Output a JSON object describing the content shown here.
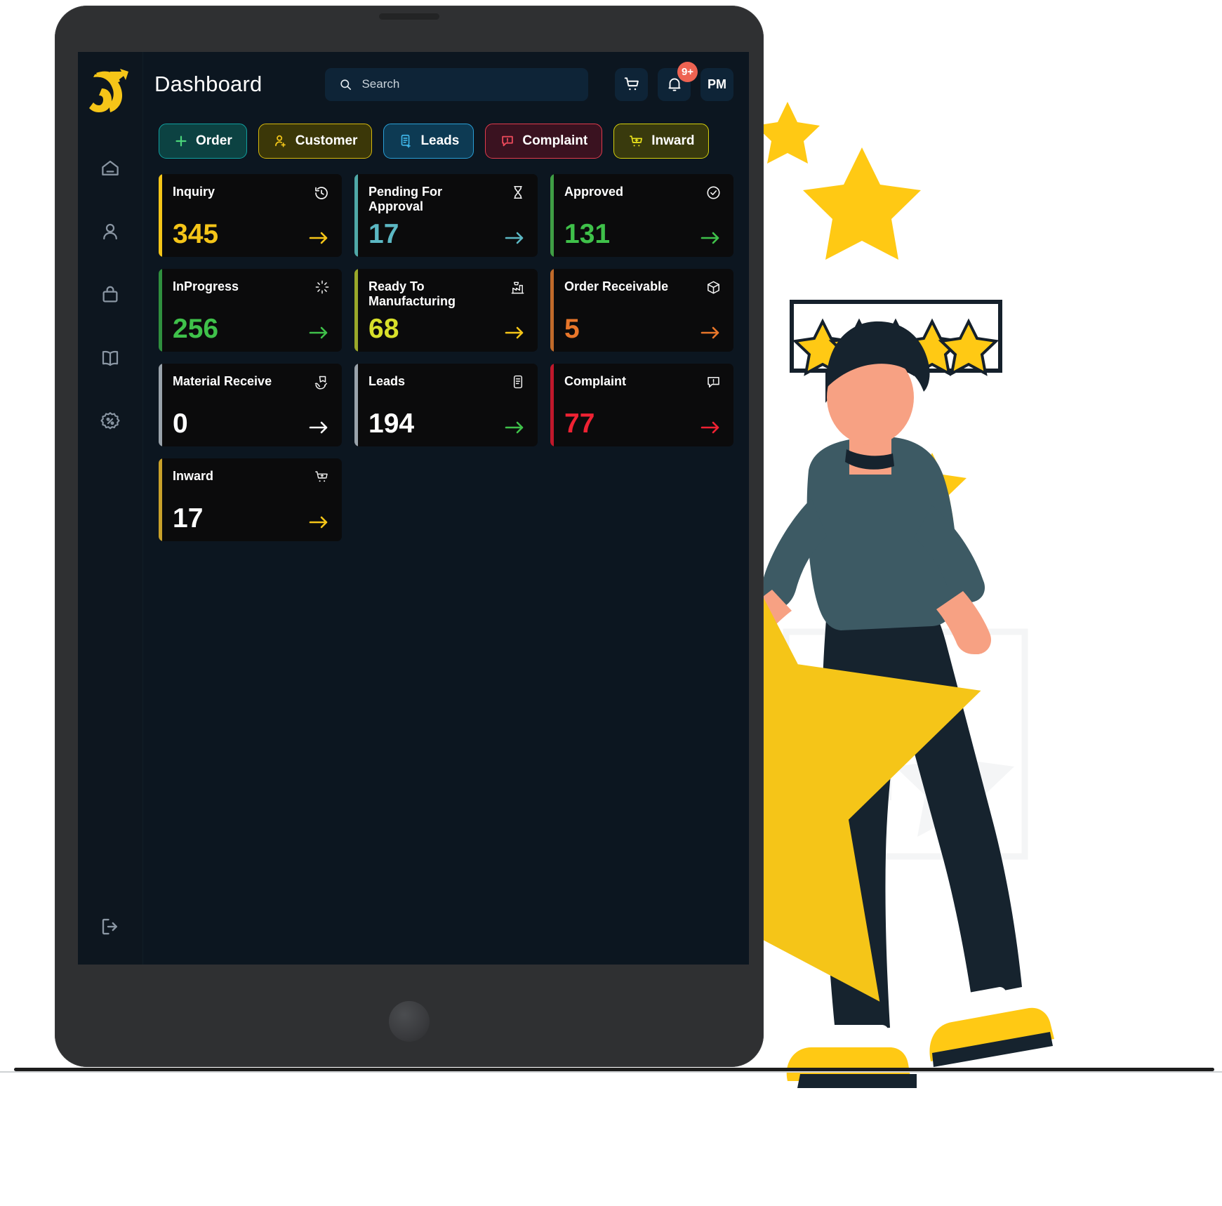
{
  "app": {
    "page_title": "Dashboard",
    "logo_name": "brand-logo"
  },
  "search": {
    "placeholder": "Search",
    "value": ""
  },
  "topbar": {
    "cart_icon": "cart-icon",
    "bell_icon": "bell-icon",
    "notification_count": "9+",
    "avatar_initials": "PM"
  },
  "sidebar": {
    "items": [
      {
        "icon": "home-icon",
        "name": "sidebar-item-home"
      },
      {
        "icon": "user-icon",
        "name": "sidebar-item-users"
      },
      {
        "icon": "bag-icon",
        "name": "sidebar-item-orders"
      },
      {
        "icon": "book-icon",
        "name": "sidebar-item-catalog"
      },
      {
        "icon": "percent-badge-icon",
        "name": "sidebar-item-offers"
      }
    ],
    "logout_icon": "logout-icon"
  },
  "quick_actions": [
    {
      "label": "Order",
      "icon": "plus-icon",
      "border": "#11a0a0",
      "bg": "#0c4242",
      "icon_color": "#4bd47a"
    },
    {
      "label": "Customer",
      "icon": "user-plus-icon",
      "border": "#d6b80d",
      "bg": "#3b3708",
      "icon_color": "#f0c419"
    },
    {
      "label": "Leads",
      "icon": "leads-doc-icon",
      "border": "#2a9fd6",
      "bg": "#0d3a53",
      "icon_color": "#3fb5e8"
    },
    {
      "label": "Complaint",
      "icon": "complaint-icon",
      "border": "#e03b4d",
      "bg": "#3a1220",
      "icon_color": "#ef4b5c"
    },
    {
      "label": "Inward",
      "icon": "inward-cart-icon",
      "border": "#d6d10d",
      "bg": "#393a0d",
      "icon_color": "#ece41c"
    }
  ],
  "stat_cards": [
    {
      "title": "Inquiry",
      "value": "345",
      "icon": "history-icon",
      "accent": "#f5c518",
      "value_color": "#f5c518",
      "arrow_color": "#f5c518"
    },
    {
      "title": "Pending For Approval",
      "value": "17",
      "icon": "hourglass-icon",
      "accent": "#4fa8a8",
      "value_color": "#5cb8c4",
      "arrow_color": "#5cb8c4"
    },
    {
      "title": "Approved",
      "value": "131",
      "icon": "check-circle-icon",
      "accent": "#3f9e44",
      "value_color": "#3fc14a",
      "arrow_color": "#3fc14a"
    },
    {
      "title": "InProgress",
      "value": "256",
      "icon": "spinner-icon",
      "accent": "#2f8f3e",
      "value_color": "#3fc14a",
      "arrow_color": "#3fc14a"
    },
    {
      "title": "Ready To Manufacturing",
      "value": "68",
      "icon": "factory-icon",
      "accent": "#9aa82a",
      "value_color": "#d8e02a",
      "arrow_color": "#f5c518"
    },
    {
      "title": "Order Receivable",
      "value": "5",
      "icon": "box-icon",
      "accent": "#c06a2a",
      "value_color": "#e8762a",
      "arrow_color": "#e8762a"
    },
    {
      "title": "Material Receive",
      "value": "0",
      "icon": "package-hand-icon",
      "accent": "#9aa3ab",
      "value_color": "#ffffff",
      "arrow_color": "#ffffff"
    },
    {
      "title": "Leads",
      "value": "194",
      "icon": "list-doc-icon",
      "accent": "#9aa3ab",
      "value_color": "#ffffff",
      "arrow_color": "#3fc14a"
    },
    {
      "title": "Complaint",
      "value": "77",
      "icon": "chat-alert-icon",
      "accent": "#c0182b",
      "value_color": "#ef2233",
      "arrow_color": "#ef2233"
    },
    {
      "title": "Inward",
      "value": "17",
      "icon": "cart-plus-icon",
      "accent": "#c9a12a",
      "value_color": "#ffffff",
      "arrow_color": "#f5c518"
    }
  ],
  "illustration": {
    "rating_stars": 5,
    "star_color": "#ffc914",
    "accent_dark": "#1b2b3a"
  }
}
